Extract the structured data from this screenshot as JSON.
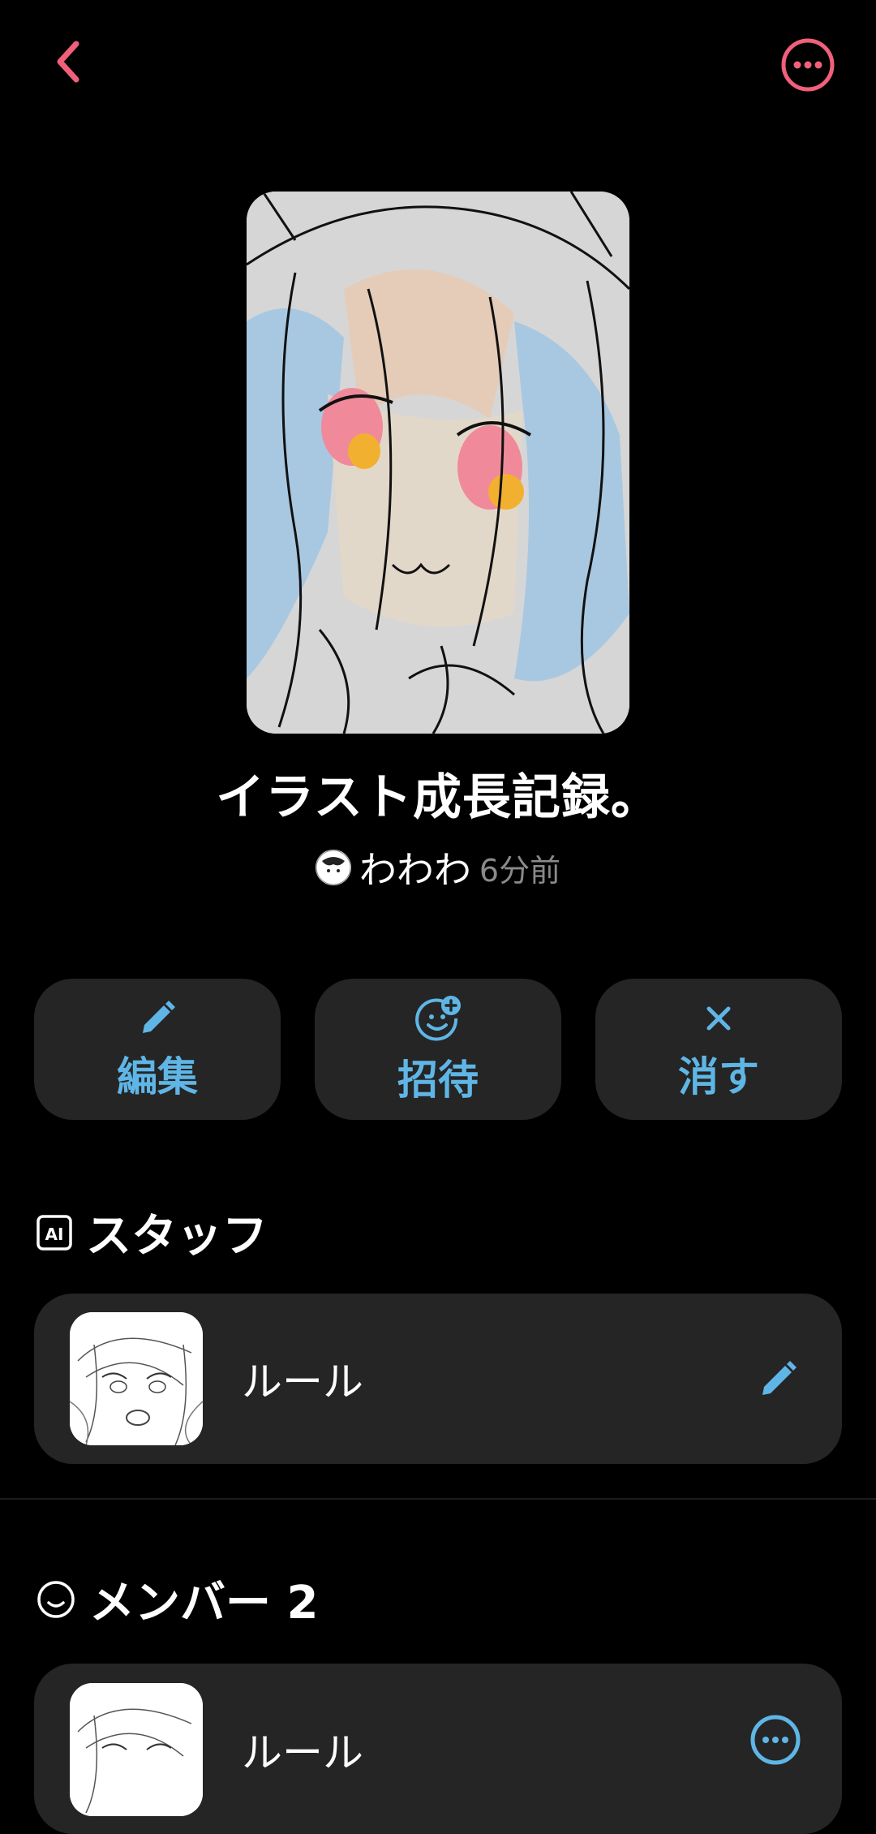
{
  "header": {
    "back_icon": "chevron-left-icon",
    "more_icon": "more-horizontal-circle-icon",
    "accent": "#f0607a"
  },
  "cover": {
    "alt": "illustration-sketch"
  },
  "title": "イラスト成長記録。",
  "meta": {
    "author": "わわわ",
    "time": "6分前"
  },
  "actions": [
    {
      "label": "編集",
      "icon": "pencil-icon"
    },
    {
      "label": "招待",
      "icon": "smile-plus-icon"
    },
    {
      "label": "消す",
      "icon": "close-icon"
    }
  ],
  "staff_section": {
    "title": "スタッフ",
    "icon": "ai-badge-icon",
    "item": {
      "name": "ルール",
      "action_icon": "pencil-icon"
    }
  },
  "members_section": {
    "title": "メンバー 2",
    "icon": "smile-icon",
    "item": {
      "name": "ルール",
      "action_icon": "more-horizontal-circle-icon"
    }
  },
  "colors": {
    "accent_blue": "#5fb6e6",
    "card_bg": "#252525",
    "accent_pink": "#f0607a"
  }
}
